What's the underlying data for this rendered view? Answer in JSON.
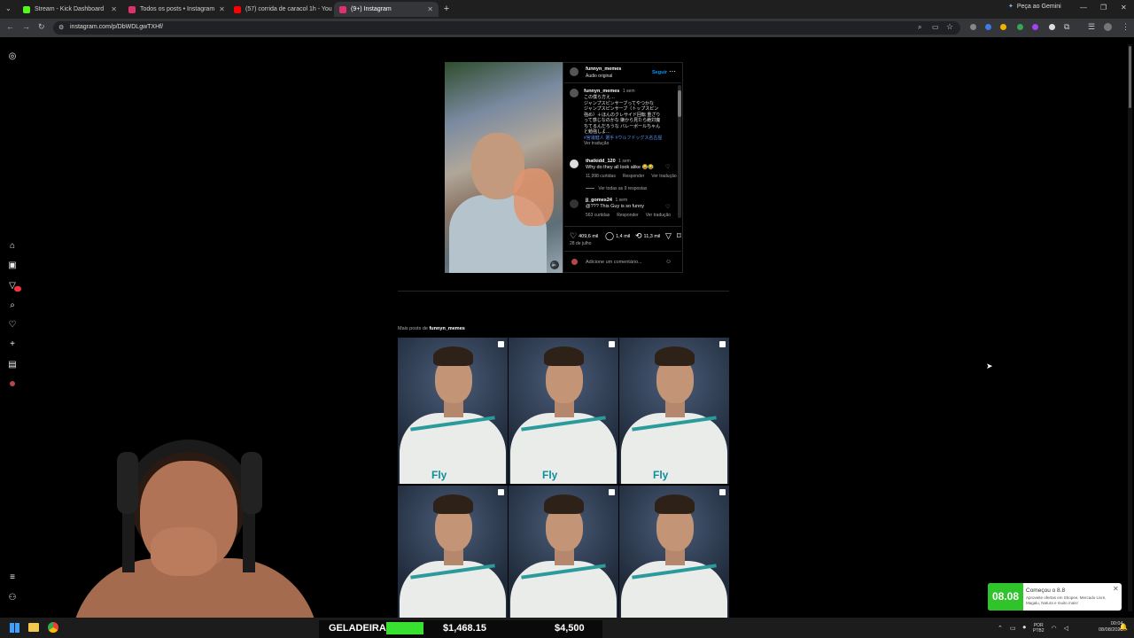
{
  "browser": {
    "tabs": [
      {
        "title": "Stream - Kick Dashboard",
        "favicon_color": "#53fc18",
        "active": false
      },
      {
        "title": "Todos os posts • Instagram",
        "favicon_color": "#e1306c",
        "active": false
      },
      {
        "title": "(57) corrida de caracol 1h - You",
        "favicon_color": "#ff0000",
        "active": false
      },
      {
        "title": "(9+) Instagram",
        "favicon_color": "#e1306c",
        "active": true
      }
    ],
    "gemini_label": "Peça ao Gemini",
    "url": "instagram.com/p/DbWDLgwTXHf/"
  },
  "post": {
    "header_user": "funnyn_memes",
    "audio": "Áudio original",
    "follow_label": "Seguir",
    "caption_user": "funnyn_memes",
    "caption_age": "1 sem",
    "caption_lines": [
      "この僕ら方え…",
      "ジャンプスピンサーブってやつかな",
      "ジャンプスピンサーブ（トップスピン",
      "強め）＋ほんのクレサイド回転 重ざり",
      "って感じなのかな 嫌から見たら絶対魔",
      "ちてるんだろうな バレーボールちゃん",
      "と勉強しよ…"
    ],
    "caption_hashtags": "#宮浦健人 選手 #ウルフドッグス名古屋",
    "see_translation": "Ver tradução",
    "comments": [
      {
        "user": "thatkidd_120",
        "age": "1 sem",
        "text": "Why do they all look alike 😂😂",
        "likes": "11,998 curtidas",
        "reply": "Responder",
        "translate": "Ver tradução",
        "replies": "Ver todas as 9 respostas"
      },
      {
        "user": "jj_gomes24",
        "age": "1 sem",
        "text": "@??? This Guy is so funny",
        "likes": "563 curtidas",
        "reply": "Responder",
        "translate": "Ver tradução"
      }
    ],
    "likes": "409,6 mil",
    "comments_count": "1,4 mil",
    "reposts": "11,3 mil",
    "date": "28 de julho",
    "comment_placeholder": "Adicione um comentário..."
  },
  "more_posts": {
    "prefix": "Mais posts de",
    "user": "funnyn_memes",
    "tile_text": "Fly"
  },
  "stream_overlay": {
    "label": "GELADEIRA",
    "amount1": "$1,468.15",
    "amount2": "$4,500"
  },
  "notification": {
    "badge": "08.08",
    "title": "Começou o 8.8",
    "subtitle": "Aproveite ofertas em Shopee, Mercado Livre, Magalu, Natura e muito mais!"
  },
  "taskbar": {
    "lang": "POR",
    "layout": "PTB2",
    "time": "00:04",
    "date": "08/08/2026"
  }
}
